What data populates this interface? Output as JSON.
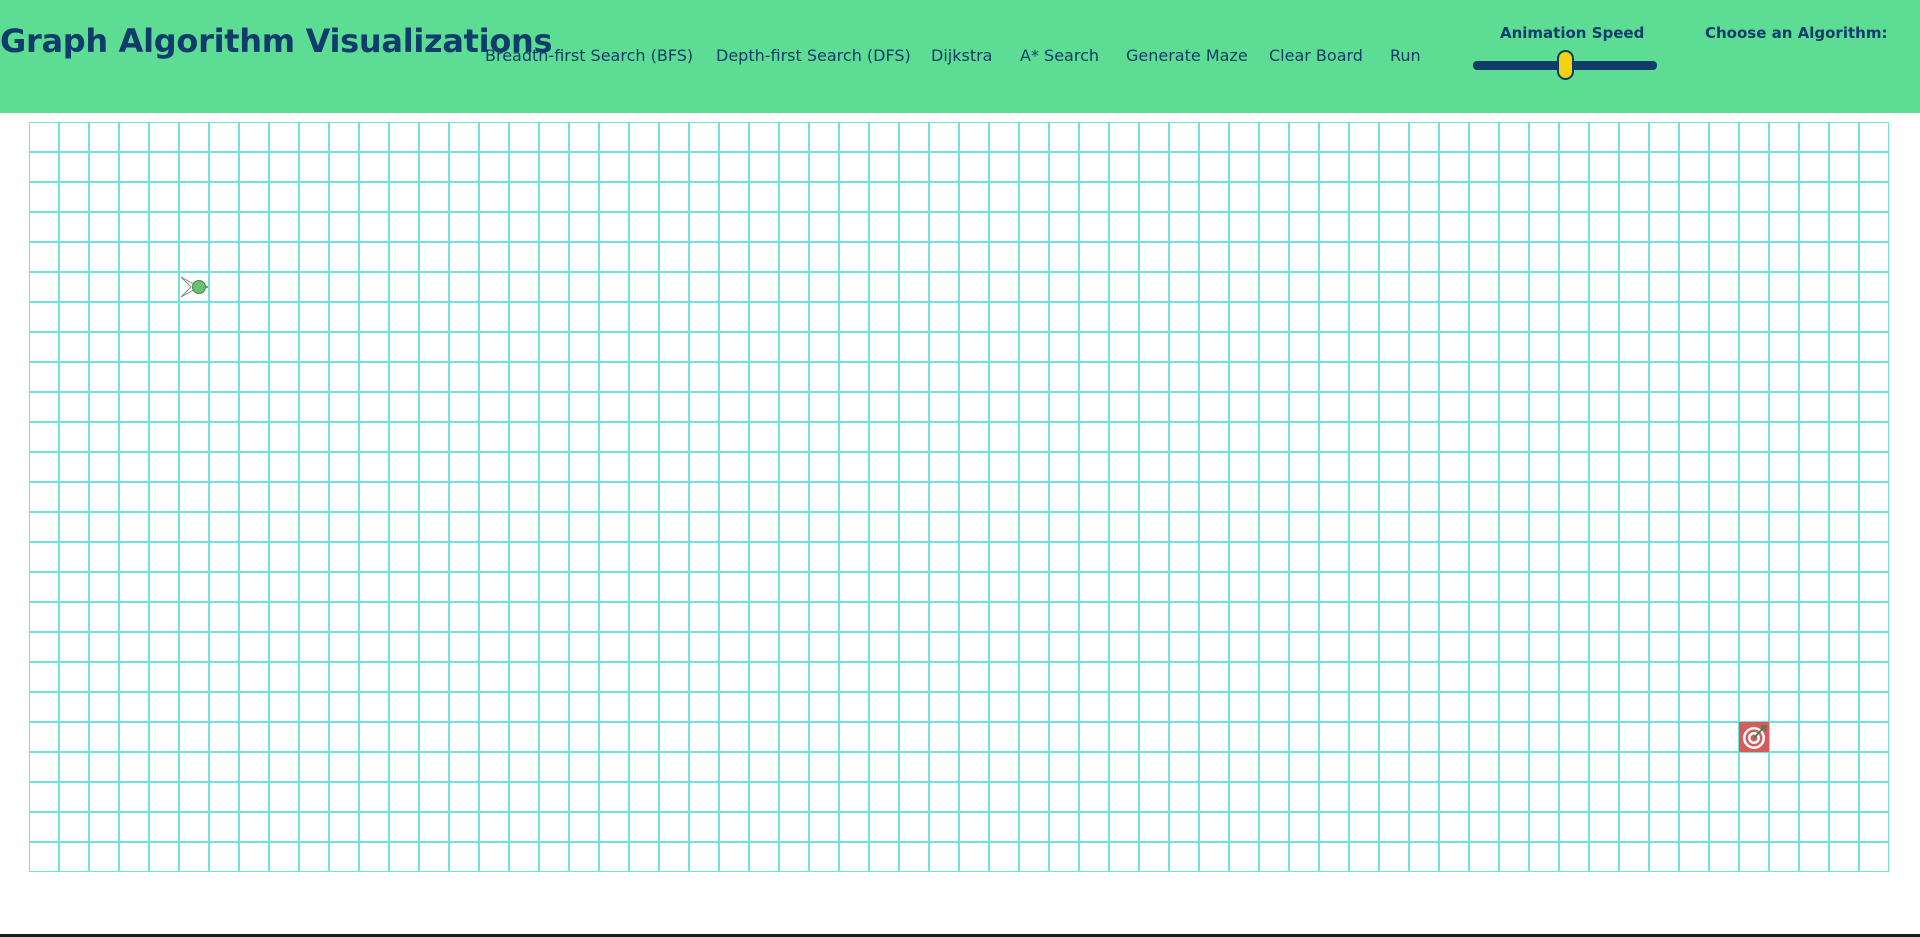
{
  "header": {
    "title": "Graph Algorithm Visualizations",
    "nav": [
      {
        "label": "Breadth-first Search (BFS)"
      },
      {
        "label": "Depth-first Search (DFS)"
      },
      {
        "label": "Dijkstra"
      },
      {
        "label": "A* Search"
      },
      {
        "label": "Generate Maze"
      },
      {
        "label": "Clear Board"
      },
      {
        "label": "Run"
      }
    ],
    "speed": {
      "label": "Animation Speed",
      "value": 0.5
    },
    "algorithm_label": "Choose an Algorithm:"
  },
  "board": {
    "rows": 25,
    "cols": 62,
    "start": {
      "row": 5,
      "col": 5
    },
    "target": {
      "row": 20,
      "col": 57
    }
  },
  "colors": {
    "navbar": "#5ddd94",
    "text": "#0f3c6a",
    "cell_border": "#6fe3dc",
    "slider_thumb": "#f4d20d",
    "start_node": "#6fbf73",
    "target_node": "#d65b5b"
  },
  "icons": {
    "start": "arrow-head-icon",
    "target": "bullseye-icon"
  }
}
